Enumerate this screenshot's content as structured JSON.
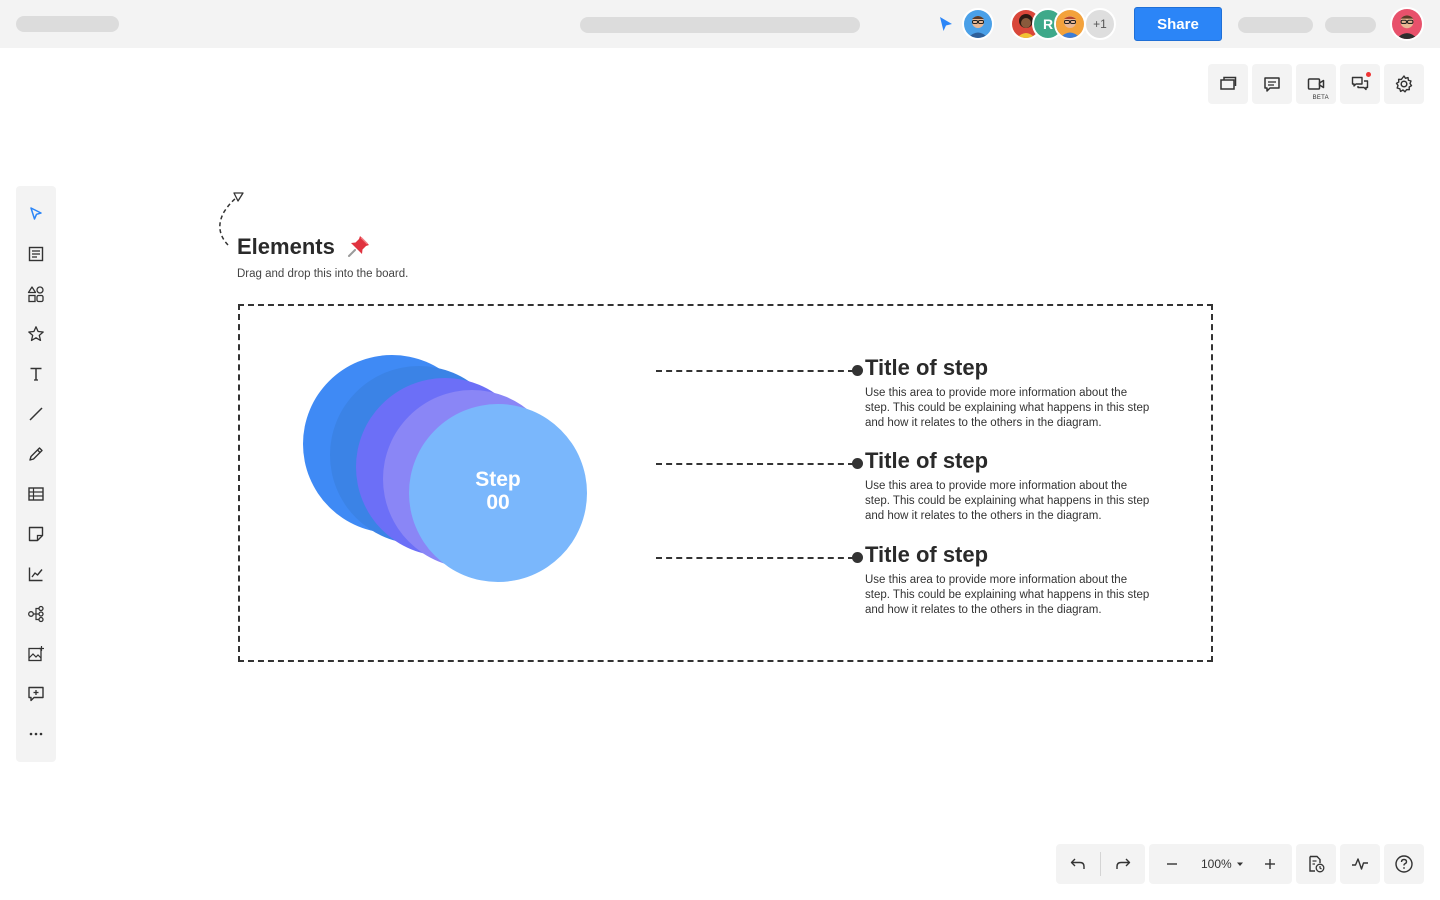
{
  "topbar": {
    "share_label": "Share",
    "collaborators_more": "+1",
    "collaborator_initial": "R",
    "accent_color": "#2b85f7"
  },
  "right_tools": [
    {
      "name": "slides-icon"
    },
    {
      "name": "comment-icon"
    },
    {
      "name": "video-icon",
      "badge": "BETA"
    },
    {
      "name": "chat-icon"
    },
    {
      "name": "gear-icon"
    }
  ],
  "left_toolbar": [
    "select-icon",
    "notes-icon",
    "shapes-icon",
    "star-icon",
    "text-icon",
    "line-icon",
    "pen-icon",
    "table-icon",
    "sticky-note-icon",
    "chart-icon",
    "mindmap-icon",
    "image-icon",
    "add-comment-icon",
    "more-icon"
  ],
  "board": {
    "title": "Elements",
    "subtitle": "Drag and drop this into the board.",
    "circle_label_line1": "Step",
    "circle_label_line2": "00",
    "circle_colors": [
      "#3f8af5",
      "#3b83e6",
      "#6c6ff7",
      "#8a86f6",
      "#7ab7fc"
    ],
    "steps": [
      {
        "title": "Title of step",
        "description": "Use this area to provide more information about the step. This could be explaining what happens in this step and how it relates to the others in the diagram."
      },
      {
        "title": "Title of step",
        "description": "Use this area to provide more information about the step. This could be explaining what happens in this step and how it relates to the others in the diagram."
      },
      {
        "title": "Title of step",
        "description": "Use this area to provide more information about the step. This could be explaining what happens in this step and how it relates to the others in the diagram."
      }
    ]
  },
  "bottom_tools": {
    "zoom": "100%"
  }
}
